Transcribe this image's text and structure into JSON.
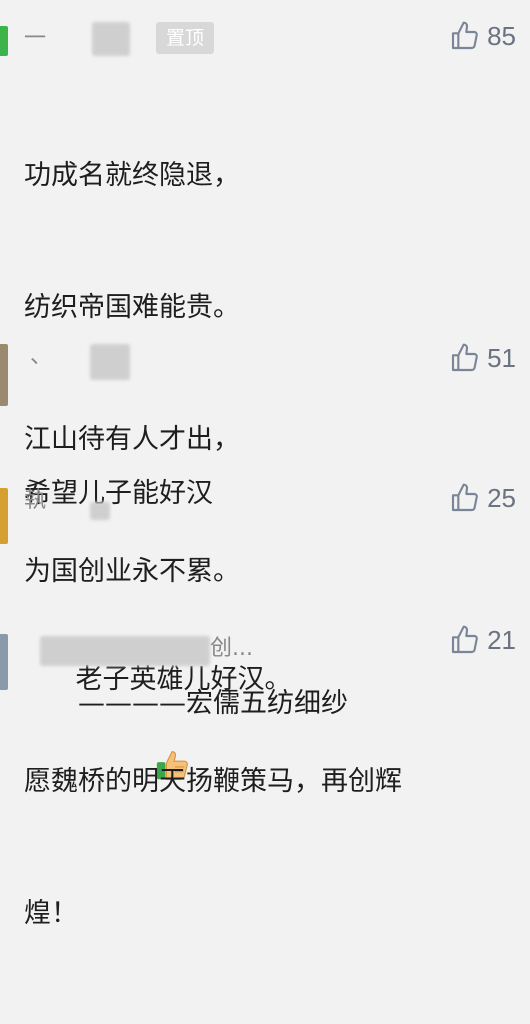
{
  "comments": [
    {
      "nickname": "一",
      "pin_label": "置顶",
      "likes": "85",
      "lines": [
        "功成名就终隐退，",
        "纺织帝国难能贵。",
        "江山待有人才出，",
        "为国创业永不累。",
        "————宏儒五纺细纱"
      ],
      "avatar_color": "#3cb44a"
    },
    {
      "nickname": "、",
      "likes": "51",
      "lines": [
        "希望儿子能好汉"
      ],
      "avatar_color": "#9a8a70"
    },
    {
      "nickname": "執",
      "likes": "25",
      "lines": [
        "老子英雄儿好汉。"
      ],
      "emoji": "thumbs-up-emoji",
      "avatar_color": "#d6a030"
    },
    {
      "nickname": "创...",
      "likes": "21",
      "lines": [
        "愿魏桥的明天扬鞭策马，再创辉",
        "煌！"
      ],
      "avatar_color": "#8a9aa8"
    }
  ],
  "icons": {
    "like": "thumbs-up-outline-icon"
  },
  "colors": {
    "like_icon": "#7a8598",
    "text": "#1e1e1e",
    "nickname": "#888888",
    "pin_bg": "#d8d8d8"
  }
}
